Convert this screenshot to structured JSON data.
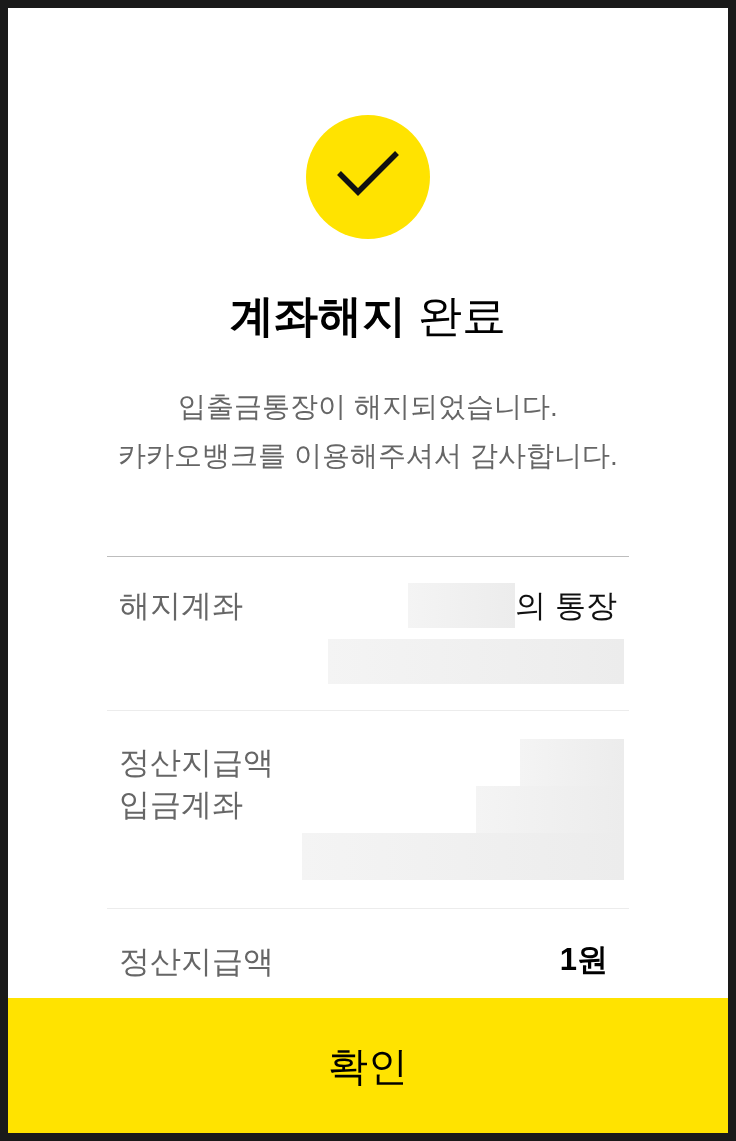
{
  "title": "**계좌해지** 완료",
  "message": [
    "입출금통장이 해지되었습니다.",
    "카카오뱅크를 이용해주셔서 감사합니다."
  ],
  "details": [
    {
      "label": "해지계좌",
      "lines": [
        [
          {
            "kind": "redacted"
          },
          {
            "kind": "text",
            "text": "의 통장"
          }
        ],
        [
          {
            "kind": "redacted"
          }
        ]
      ]
    },
    {
      "label": "정산지급액\n입금계좌",
      "lines": [
        [
          {
            "kind": "redacted"
          }
        ],
        [
          {
            "kind": "redacted"
          }
        ],
        [
          {
            "kind": "redacted"
          }
        ]
      ]
    },
    {
      "label": "정산지급액",
      "lines": [
        [
          {
            "kind": "amount",
            "text": "1원"
          }
        ]
      ]
    }
  ],
  "button": {
    "label": "확인"
  }
}
